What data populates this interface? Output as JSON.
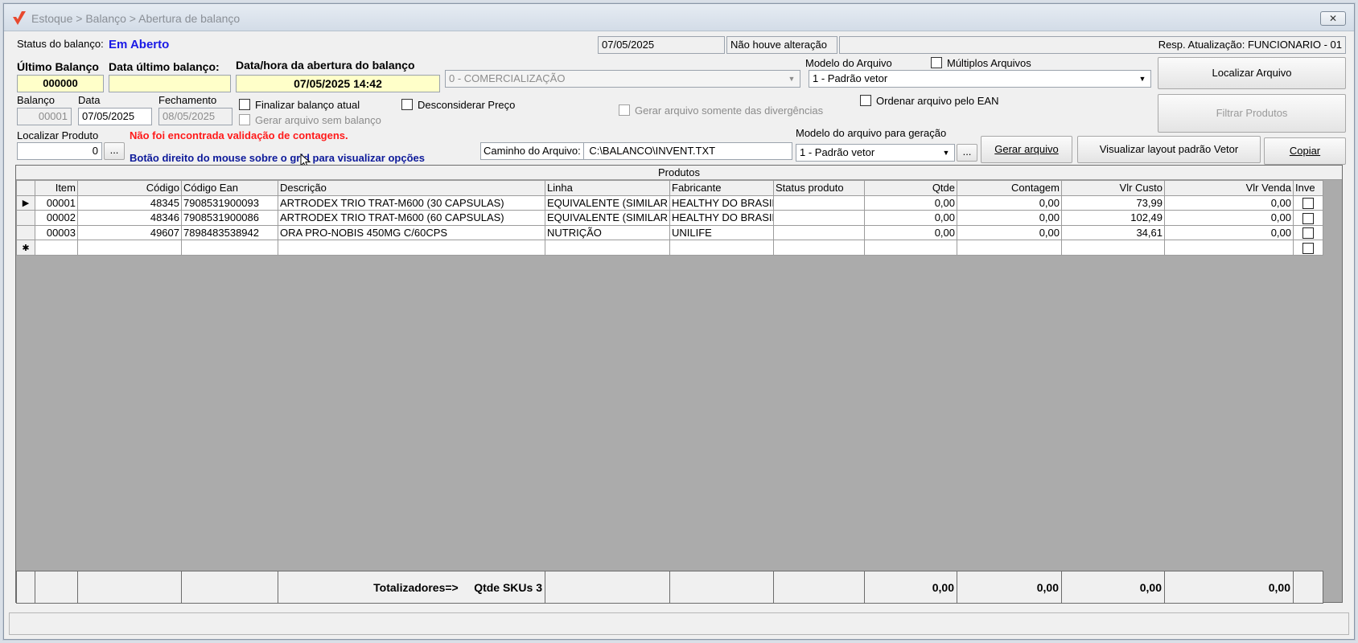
{
  "window": {
    "title": "Estoque > Balanço > Abertura de balanço",
    "close_label": "✕"
  },
  "status_row": {
    "status_label": "Status do balanço:",
    "status_value": "Em Aberto",
    "date": "07/05/2025",
    "change": "Não houve alteração",
    "resp": "Resp. Atualização: FUNCIONARIO - 01"
  },
  "header": {
    "ultimo_balanco_label": "Último Balanço",
    "ultimo_balanco_value": "000000",
    "data_ultimo_label": "Data último balanço:",
    "data_ultimo_value": "",
    "abertura_label": "Data/hora da abertura do balanço",
    "abertura_value": "07/05/2025 14:42",
    "comercializacao": "0 - COMERCIALIZAÇÃO",
    "modelo_arquivo_label": "Modelo do Arquivo",
    "modelo_arquivo_value": "1 - Padrão vetor",
    "multiplos_label": "Múltiplos Arquivos",
    "localizar_arquivo_btn": "Localizar Arquivo",
    "filtrar_btn": "Filtrar Produtos",
    "balanco_label": "Balanço",
    "balanco_value": "00001",
    "data_label": "Data",
    "data_value": "07/05/2025",
    "fechamento_label": "Fechamento",
    "fechamento_value": "08/05/2025",
    "finalizar_label": "Finalizar balanço atual",
    "gerar_sem_label": "Gerar arquivo sem balanço",
    "desconsiderar_label": "Desconsiderar Preço",
    "gerar_div_label": "Gerar arquivo somente das divergências",
    "ordenar_label": "Ordenar arquivo pelo EAN",
    "localizar_produto_label": "Localizar Produto",
    "localizar_produto_value": "0",
    "ellipsis": "...",
    "warning": "Não foi encontrada validação de contagens.",
    "hint": "Botão direito do mouse sobre o grid para visualizar opções",
    "caminho_label": "Caminho do Arquivo:",
    "caminho_value": "C:\\BALANCO\\INVENT.TXT",
    "modelo_geracao_label": "Modelo do arquivo para geração",
    "modelo_geracao_value": "1 - Padrão vetor",
    "gerar_btn": "Gerar arquivo",
    "visualizar_btn": "Visualizar layout padrão Vetor",
    "copiar_btn": "Copiar"
  },
  "grid": {
    "title": "Produtos",
    "columns": [
      "Item",
      "Código",
      "Código Ean",
      "Descrição",
      "Linha",
      "Fabricante",
      "Status produto",
      "Qtde",
      "Contagem",
      "Vlr Custo",
      "Vlr Venda",
      "Inve"
    ],
    "rows": [
      {
        "item": "00001",
        "codigo": "48345",
        "ean": "7908531900093",
        "descricao": "ARTRODEX TRIO TRAT-M600 (30 CAPSULAS)",
        "linha": "EQUIVALENTE (SIMILAR",
        "fabricante": "HEALTHY DO BRASIL",
        "status": "",
        "qtde": "0,00",
        "contagem": "0,00",
        "custo": "73,99",
        "venda": "0,00"
      },
      {
        "item": "00002",
        "codigo": "48346",
        "ean": "7908531900086",
        "descricao": "ARTRODEX TRIO TRAT-M600 (60 CAPSULAS)",
        "linha": "EQUIVALENTE (SIMILAR",
        "fabricante": "HEALTHY DO BRASIL",
        "status": "",
        "qtde": "0,00",
        "contagem": "0,00",
        "custo": "102,49",
        "venda": "0,00"
      },
      {
        "item": "00003",
        "codigo": "49607",
        "ean": "7898483538942",
        "descricao": "ORA PRO-NOBIS 450MG C/60CPS",
        "linha": "NUTRIÇÃO",
        "fabricante": "UNILIFE",
        "status": "",
        "qtde": "0,00",
        "contagem": "0,00",
        "custo": "34,61",
        "venda": "0,00"
      }
    ],
    "new_row_marker": "✱",
    "current_row_marker": "▶",
    "totals": {
      "label": "Totalizadores=>",
      "skus": "Qtde SKUs 3",
      "qtde": "0,00",
      "contagem": "0,00",
      "custo": "0,00",
      "venda": "0,00"
    }
  }
}
